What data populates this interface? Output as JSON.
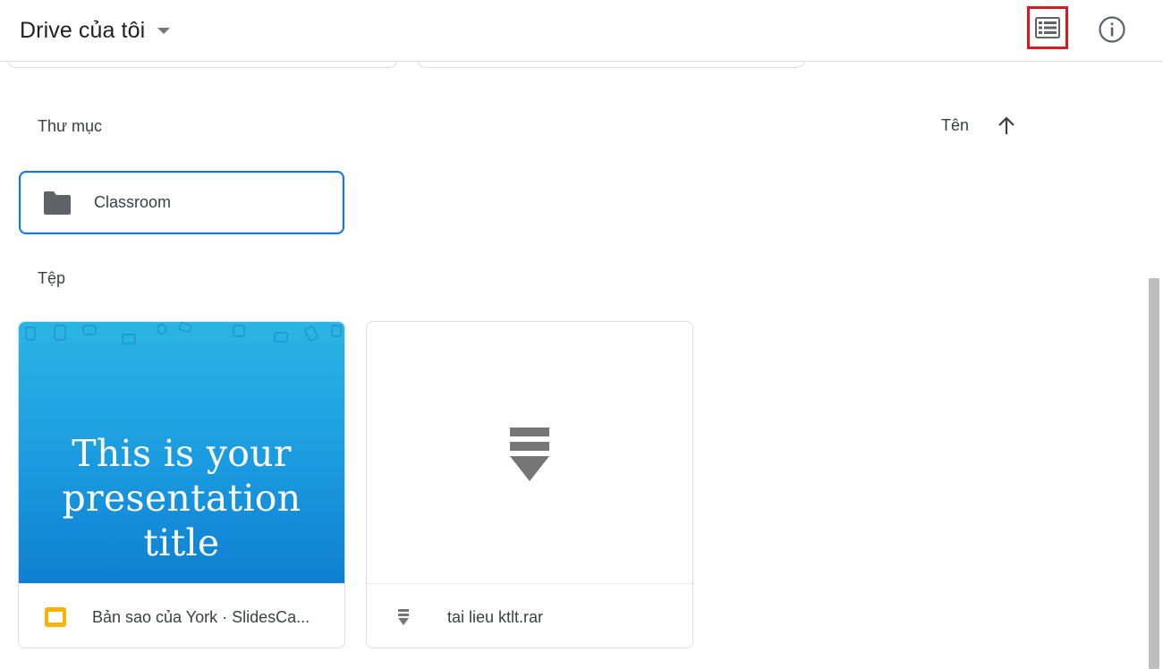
{
  "header": {
    "title": "Drive của tôi",
    "list_view_highlight_color": "#e0161e"
  },
  "sections": {
    "folders_label": "Thư mục",
    "files_label": "Tệp",
    "sort_label": "Tên"
  },
  "folders": [
    {
      "name": "Classroom",
      "icon": "folder-icon"
    }
  ],
  "files": [
    {
      "name": "Bản sao của York · SlidesCa...",
      "icon": "google-slides-icon",
      "icon_color": "#f4b400",
      "thumbnail_text_line1": "This is your",
      "thumbnail_text_line2": "presentation title"
    },
    {
      "name": "tai lieu ktlt.rar",
      "icon": "archive-icon"
    }
  ],
  "colors": {
    "accent_blue": "#1a73e8",
    "slide_gradient_top": "#2bb5e3",
    "slide_gradient_bottom": "#0f7fd1"
  }
}
